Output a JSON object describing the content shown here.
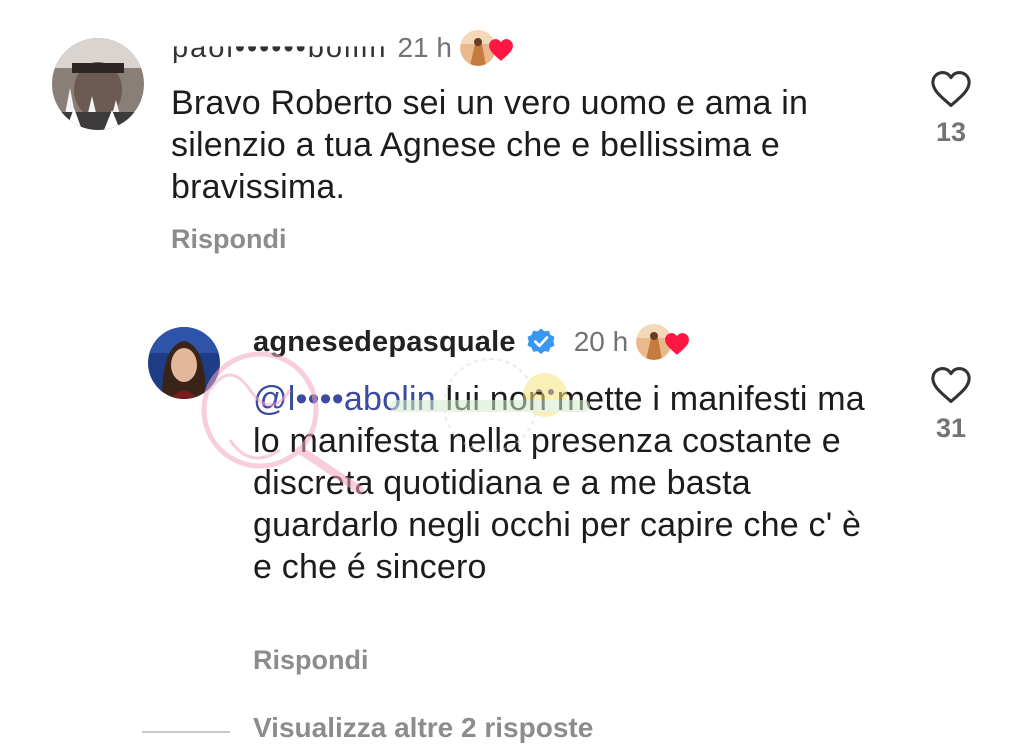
{
  "comments": [
    {
      "username": "paol••••••boliin",
      "time": "21 h",
      "text": "Bravo Roberto sei un vero uomo e ama in silenzio  a tua Agnese che e bellissima e bravissima.",
      "reply_label": "Rispondi",
      "like_count": "13"
    },
    {
      "username": "agnesedepasquale",
      "time": "20 h",
      "mention": "@l••••abolin",
      "text": " lui non mette i manifesti ma lo manifesta nella presenza costante e discreta quotidiana e a me basta guardarlo negli occhi per capire che c' è  e che é sincero",
      "reply_label": "Rispondi",
      "like_count": "31"
    }
  ],
  "view_more": "Visualizza altre 2 risposte",
  "colors": {
    "heart_red": "#ff1744",
    "verified_blue": "#3897f0",
    "secondary_text": "#737373"
  },
  "icons": {
    "like": "heart-outline-icon",
    "creator_like": "heart-filled-icon",
    "verified": "verified-badge-icon"
  }
}
